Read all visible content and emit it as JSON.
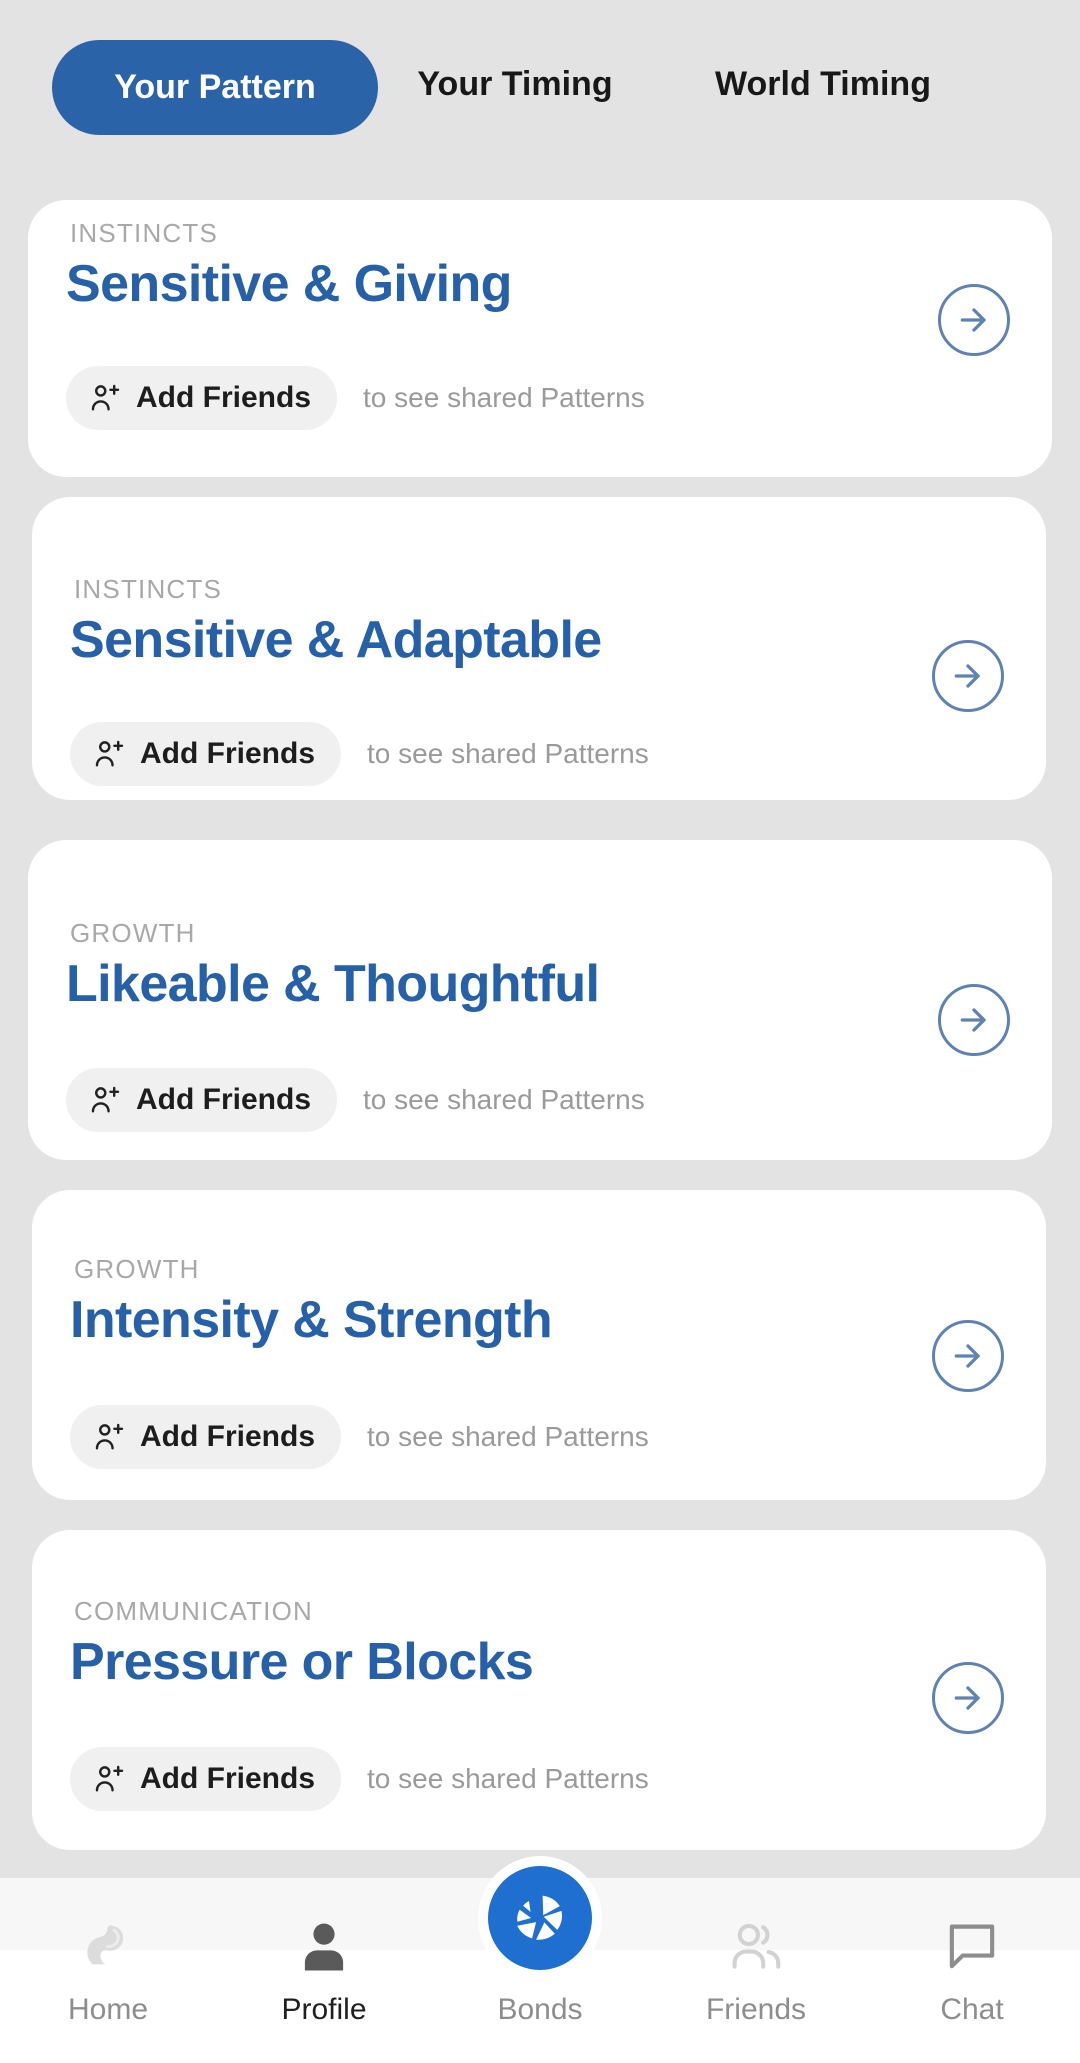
{
  "tabs": [
    {
      "label": "Your Pattern",
      "active": true
    },
    {
      "label": "Your Timing",
      "active": false
    },
    {
      "label": "World Timing",
      "active": false
    }
  ],
  "cards": [
    {
      "category": "INSTINCTS",
      "title": "Sensitive & Giving",
      "add_label": "Add Friends",
      "hint": "to see shared Patterns"
    },
    {
      "category": "INSTINCTS",
      "title": "Sensitive & Adaptable",
      "add_label": "Add Friends",
      "hint": "to see shared Patterns"
    },
    {
      "category": "GROWTH",
      "title": "Likeable & Thoughtful",
      "add_label": "Add Friends",
      "hint": "to see shared Patterns"
    },
    {
      "category": "GROWTH",
      "title": "Intensity & Strength",
      "add_label": "Add Friends",
      "hint": "to see shared Patterns"
    },
    {
      "category": "COMMUNICATION",
      "title": "Pressure or Blocks",
      "add_label": "Add Friends",
      "hint": "to see shared Patterns"
    }
  ],
  "bottom_nav": [
    {
      "label": "Home",
      "icon": "home-photo-icon",
      "active": false
    },
    {
      "label": "Profile",
      "icon": "person-icon",
      "active": true
    },
    {
      "label": "Bonds",
      "icon": "pinwheel-icon",
      "active": false
    },
    {
      "label": "Friends",
      "icon": "two-people-icon",
      "active": false
    },
    {
      "label": "Chat",
      "icon": "speech-bubble-icon",
      "active": false
    }
  ],
  "colors": {
    "page_background": "#e3e3e3",
    "card_background": "#ffffff",
    "accent_blue": "#2b63a8",
    "title_blue": "#2560a8",
    "arrow_blue": "#5e82b4",
    "bonds_blue": "#1f6fd0",
    "category_gray": "#a8a8a8",
    "hint_gray": "#9a9a9a",
    "pill_background": "#f0f0f0"
  }
}
